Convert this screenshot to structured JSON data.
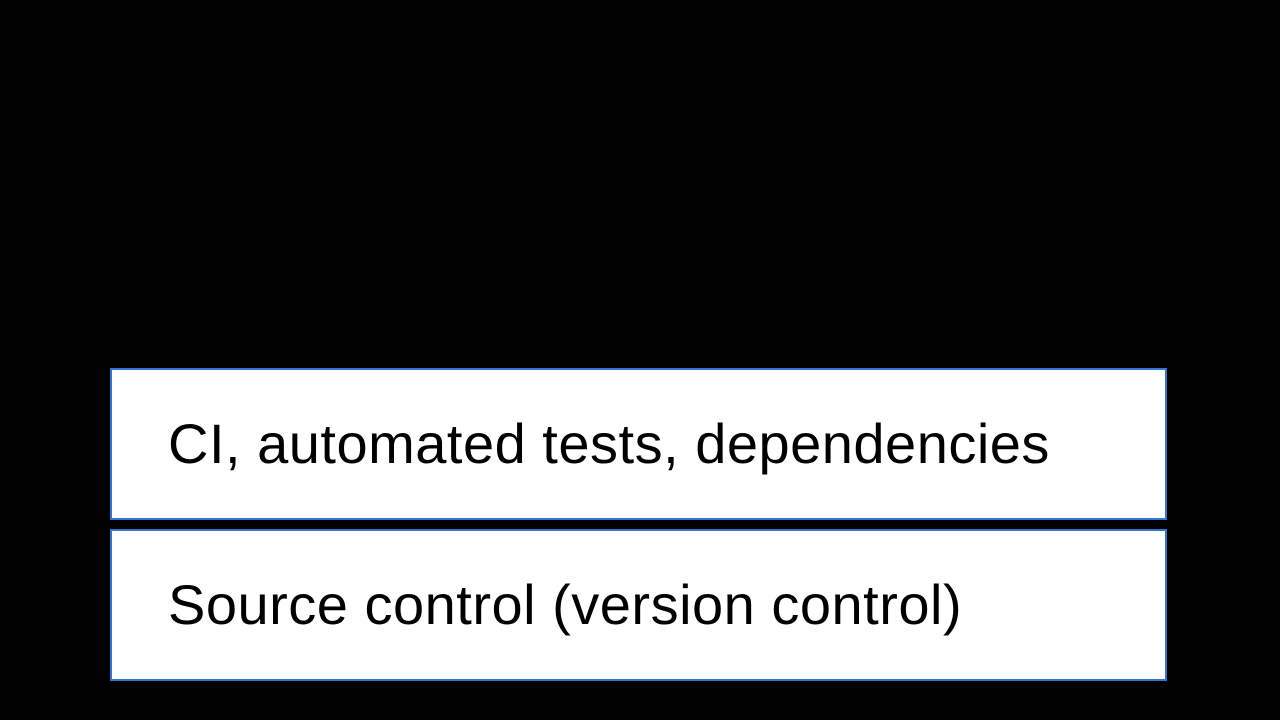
{
  "boxes": {
    "top": {
      "label": "CI, automated tests, dependencies"
    },
    "bottom": {
      "label": "Source control (version control)"
    }
  },
  "colors": {
    "background": "#000000",
    "box_fill": "#ffffff",
    "box_border": "#2e75d6",
    "text": "#000000"
  }
}
